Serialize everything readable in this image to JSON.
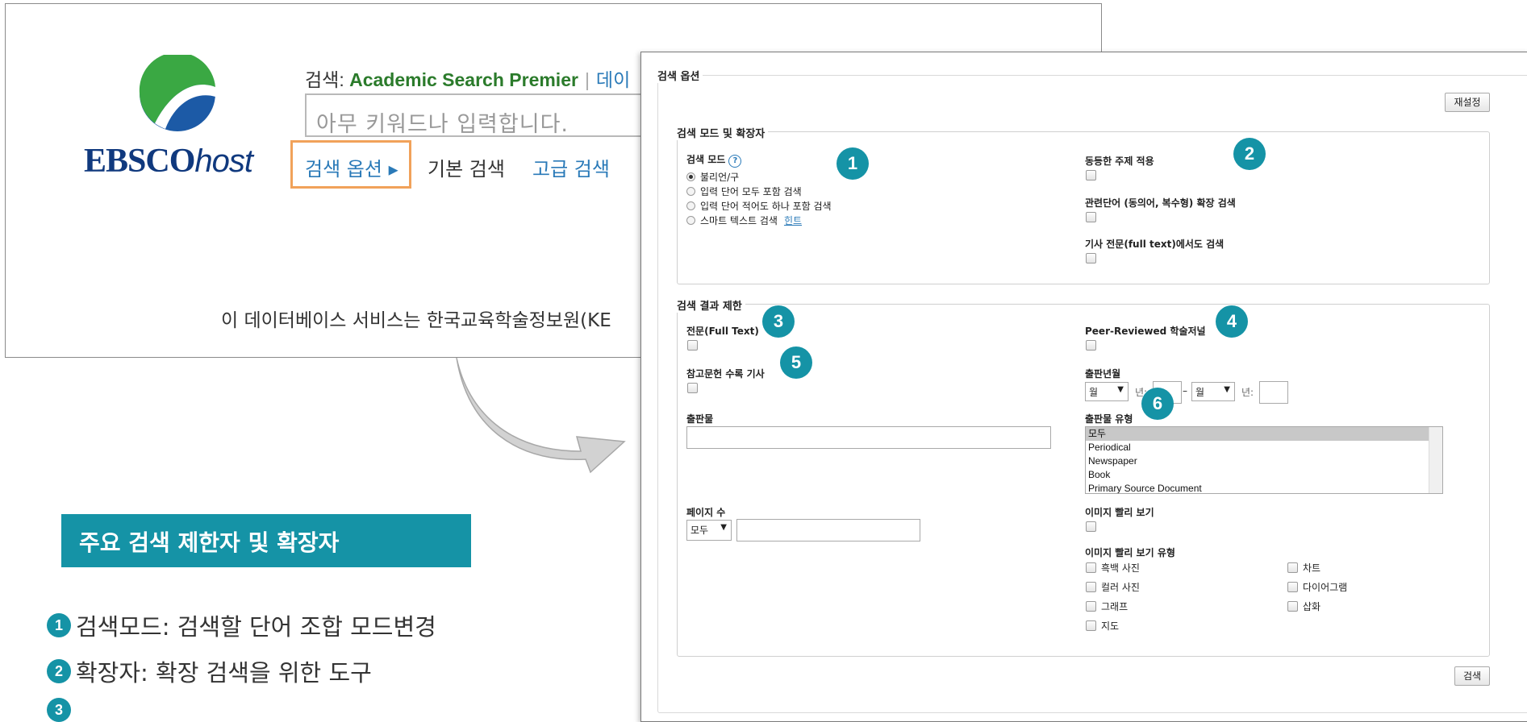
{
  "bg": {
    "logo_text_main": "EBSCO",
    "logo_text_host": "host",
    "db_prefix": "검색: ",
    "db_name": "Academic Search Premier",
    "db_more": "데이",
    "search_placeholder": "아무 키워드나 입력합니다.",
    "link_options": "검색 옵션 ▸",
    "link_basic": "기본 검색",
    "link_advanced": "고급 검색",
    "db_note": "이 데이터베이스 서비스는 한국교육학술정보원(KE"
  },
  "legend": {
    "title": "주요 검색 제한자 및 확장자",
    "items": [
      {
        "num": "1",
        "text": "검색모드: 검색할 단어 조합 모드변경"
      },
      {
        "num": "2",
        "text": "확장자: 확장 검색을 위한 도구"
      },
      {
        "num": "3",
        "text": ""
      }
    ]
  },
  "panel": {
    "title": "검색 옵션",
    "reset_label": "재설정",
    "search_label": "검색",
    "modes_section": "검색 모드 및 확장자",
    "mode_label": "검색 모드",
    "help_glyph": "?",
    "modes": [
      "불리언/구",
      "입력 단어 모두 포함 검색",
      "입력 단어 적어도 하나 포함 검색",
      "스마트 텍스트 검색"
    ],
    "hint": "힌트",
    "expanders": [
      "동등한 주제 적용",
      "관련단어 (동의어, 복수형) 확장 검색",
      "기사 전문(full text)에서도 검색"
    ],
    "limit_section": "검색 결과 제한",
    "full_text": "전문(Full Text)",
    "peer_reviewed": "Peer-Reviewed 학술저널",
    "references": "참고문헌 수록 기사",
    "pub_date": "출판년월",
    "month_select": "월",
    "year_suffix": "년:",
    "dash": "–",
    "publication": "출판물",
    "pub_type": "출판물 유형",
    "pub_types": [
      "모두",
      "Periodical",
      "Newspaper",
      "Book",
      "Primary Source Document"
    ],
    "page_count": "페이지 수",
    "page_select": "모두",
    "image_quick": "이미지 빨리 보기",
    "image_quick_types_label": "이미지 빨리 보기 유형",
    "image_types_left": [
      "흑백 사진",
      "컬러 사진",
      "그래프",
      "지도"
    ],
    "image_types_right": [
      "차트",
      "다이어그램",
      "삽화"
    ],
    "badges": [
      "1",
      "2",
      "3",
      "4",
      "5",
      "6"
    ]
  },
  "colors": {
    "accent": "#1593a6",
    "link": "#2a7ab8",
    "highlight_box": "#f1a25a",
    "logo_blue": "#10397e",
    "db_green": "#2b7b2b"
  }
}
